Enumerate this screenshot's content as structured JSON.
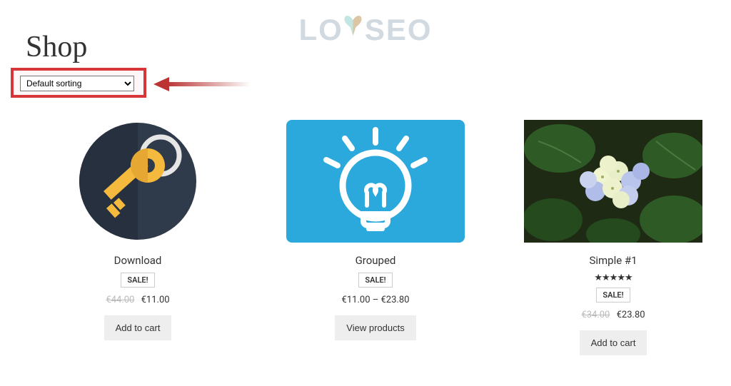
{
  "logo": {
    "text_left": "LO",
    "text_right": "SEO"
  },
  "page": {
    "title": "Shop"
  },
  "sort": {
    "selected": "Default sorting"
  },
  "products": [
    {
      "title": "Download",
      "sale_label": "SALE!",
      "old_price": "€44.00",
      "price": "€11.00",
      "button": "Add to cart",
      "rating": null,
      "price_range": null,
      "image_kind": "key"
    },
    {
      "title": "Grouped",
      "sale_label": "SALE!",
      "old_price": null,
      "price": null,
      "price_range": "€11.00 – €23.80",
      "button": "View products",
      "rating": null,
      "image_kind": "bulb"
    },
    {
      "title": "Simple #1",
      "sale_label": "SALE!",
      "old_price": "€34.00",
      "price": "€23.80",
      "price_range": null,
      "button": "Add to cart",
      "rating": 5,
      "image_kind": "flower"
    }
  ]
}
